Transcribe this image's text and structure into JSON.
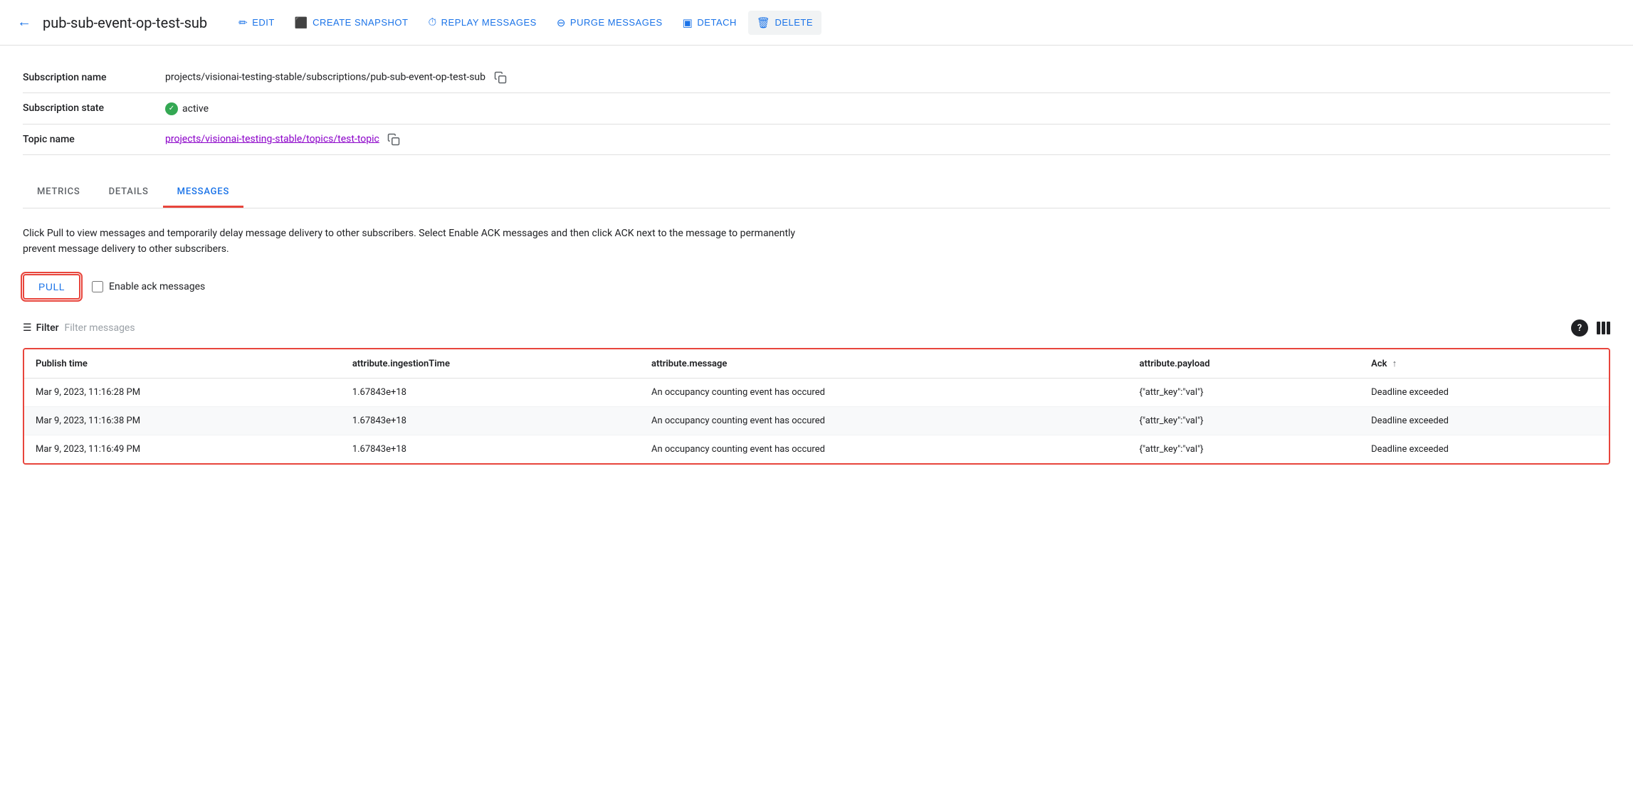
{
  "header": {
    "back_icon": "←",
    "title": "pub-sub-event-op-test-sub",
    "buttons": [
      {
        "label": "EDIT",
        "icon": "✏️",
        "name": "edit-button"
      },
      {
        "label": "CREATE SNAPSHOT",
        "icon": "📷",
        "name": "create-snapshot-button"
      },
      {
        "label": "REPLAY MESSAGES",
        "icon": "🕐",
        "name": "replay-messages-button"
      },
      {
        "label": "PURGE MESSAGES",
        "icon": "⊖",
        "name": "purge-messages-button"
      },
      {
        "label": "DETACH",
        "icon": "▣",
        "name": "detach-button"
      },
      {
        "label": "DELETE",
        "icon": "🗑",
        "name": "delete-button"
      }
    ]
  },
  "info": {
    "rows": [
      {
        "label": "Subscription name",
        "value": "projects/visionai-testing-stable/subscriptions/pub-sub-event-op-test-sub",
        "copyable": true
      },
      {
        "label": "Subscription state",
        "value": "active",
        "type": "status"
      },
      {
        "label": "Topic name",
        "value": "projects/visionai-testing-stable/topics/test-topic",
        "type": "link",
        "copyable": true
      }
    ]
  },
  "tabs": [
    {
      "label": "METRICS",
      "active": false
    },
    {
      "label": "DETAILS",
      "active": false
    },
    {
      "label": "MESSAGES",
      "active": true
    }
  ],
  "messages_tab": {
    "description": "Click Pull to view messages and temporarily delay message delivery to other subscribers. Select Enable ACK messages and then click ACK next to the message to permanently prevent message delivery to other subscribers.",
    "pull_button": "PULL",
    "enable_ack_label": "Enable ack messages",
    "filter_label": "Filter",
    "filter_placeholder": "Filter messages",
    "table": {
      "columns": [
        {
          "label": "Publish time",
          "sortable": false
        },
        {
          "label": "attribute.ingestionTime",
          "sortable": false
        },
        {
          "label": "attribute.message",
          "sortable": false
        },
        {
          "label": "attribute.payload",
          "sortable": false
        },
        {
          "label": "Ack",
          "sortable": true
        }
      ],
      "rows": [
        {
          "publish_time": "Mar 9, 2023, 11:16:28 PM",
          "ingestion_time": "1.67843e+18",
          "message": "An occupancy counting event has occured",
          "payload": "{\"attr_key\":\"val\"}",
          "ack": "Deadline exceeded"
        },
        {
          "publish_time": "Mar 9, 2023, 11:16:38 PM",
          "ingestion_time": "1.67843e+18",
          "message": "An occupancy counting event has occured",
          "payload": "{\"attr_key\":\"val\"}",
          "ack": "Deadline exceeded"
        },
        {
          "publish_time": "Mar 9, 2023, 11:16:49 PM",
          "ingestion_time": "1.67843e+18",
          "message": "An occupancy counting event has occured",
          "payload": "{\"attr_key\":\"val\"}",
          "ack": "Deadline exceeded"
        }
      ]
    }
  }
}
